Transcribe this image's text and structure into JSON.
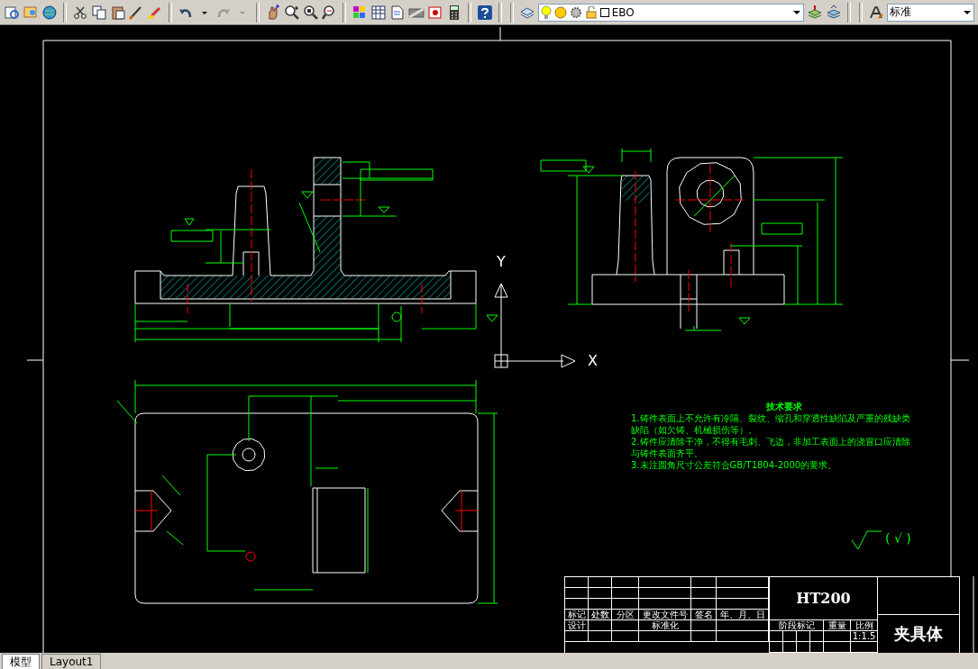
{
  "toolbar": {
    "layer": "EBO",
    "text_style": "标准"
  },
  "ucs": {
    "x_label": "X",
    "y_label": "Y"
  },
  "technical_requirements": {
    "title": "技术要求",
    "lines": [
      "1.铸件表面上不允许有冷隔、裂纹、缩孔和穿透性缺陷及严重的残缺类",
      "缺陷（如欠铸、机械损伤等）。",
      "2.铸件应清除干净，不得有毛刺、飞边，非加工表面上的浇冒口应清除",
      "与铸件表面齐平。",
      "3.未注圆角尺寸公差符合GB/T1804-2000的要求。"
    ]
  },
  "roughness_note": "( √ )",
  "title_block": {
    "headers": [
      "标记",
      "处数",
      "分区",
      "更改文件号",
      "签名",
      "年、月、日"
    ],
    "designer_label": "设计",
    "standardization_label": "标准化",
    "material": "HT200",
    "stage_label": "阶段标记",
    "weight_label": "重量",
    "scale_label": "比例",
    "scale": "1:1.5",
    "part_name": "夹具体"
  },
  "layout_tabs": [
    {
      "label": "模型",
      "selected": true
    },
    {
      "label": "Layout1",
      "selected": false
    }
  ]
}
